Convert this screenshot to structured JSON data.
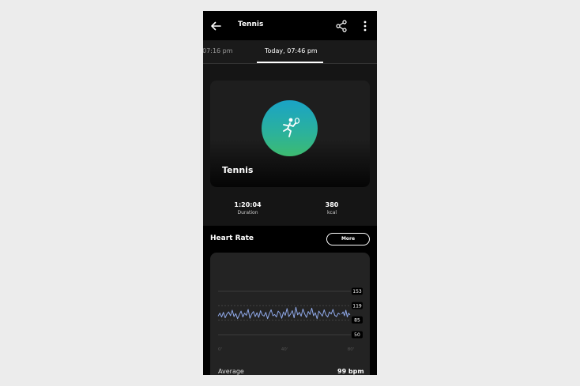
{
  "header": {
    "title": "Tennis",
    "back_icon": "back-arrow-icon",
    "share_icon": "share-icon",
    "menu_icon": "more-vertical-icon"
  },
  "tabs": [
    {
      "label": ", 07:16 pm",
      "selected": false
    },
    {
      "label": "Today, 07:46 pm",
      "selected": true
    }
  ],
  "hero": {
    "title": "Tennis",
    "icon": "tennis-player-icon",
    "gradient_colors": [
      "#1aa3c6",
      "#3dbb70"
    ]
  },
  "stats": [
    {
      "value": "1:20:04",
      "label": "Duration"
    },
    {
      "value": "380",
      "label": "kcal"
    }
  ],
  "heart_rate": {
    "title": "Heart Rate",
    "more_label": "More",
    "average_label": "Average",
    "average_value": "99 bpm",
    "line_color": "#8fa8e8"
  },
  "chart_data": {
    "type": "line",
    "xlabels": [
      "0'",
      "40'",
      "80'"
    ],
    "xlim": [
      0,
      80
    ],
    "y_ticks": [
      "153",
      "119",
      "85",
      "50"
    ],
    "ylim": [
      50,
      153
    ],
    "grid": true,
    "series": [
      {
        "values": [
          94,
          101,
          92,
          103,
          90,
          99,
          104,
          95,
          108,
          93,
          100,
          88,
          97,
          106,
          92,
          101,
          96,
          110,
          89,
          99,
          105,
          93,
          102,
          91,
          107,
          97,
          94,
          103,
          88,
          100,
          109,
          95,
          98,
          92,
          106,
          101,
          89,
          104,
          96,
          112,
          93,
          99,
          107,
          90,
          115,
          97,
          103,
          94,
          111,
          99,
          91,
          105,
          98,
          113,
          95,
          102,
          88,
          106,
          100,
          94,
          109,
          97,
          92,
          104,
          99,
          110,
          96,
          93,
          101,
          98
        ]
      },
      {
        "values": [
          99,
          104,
          95,
          108,
          92,
          101,
          97
        ]
      }
    ]
  }
}
